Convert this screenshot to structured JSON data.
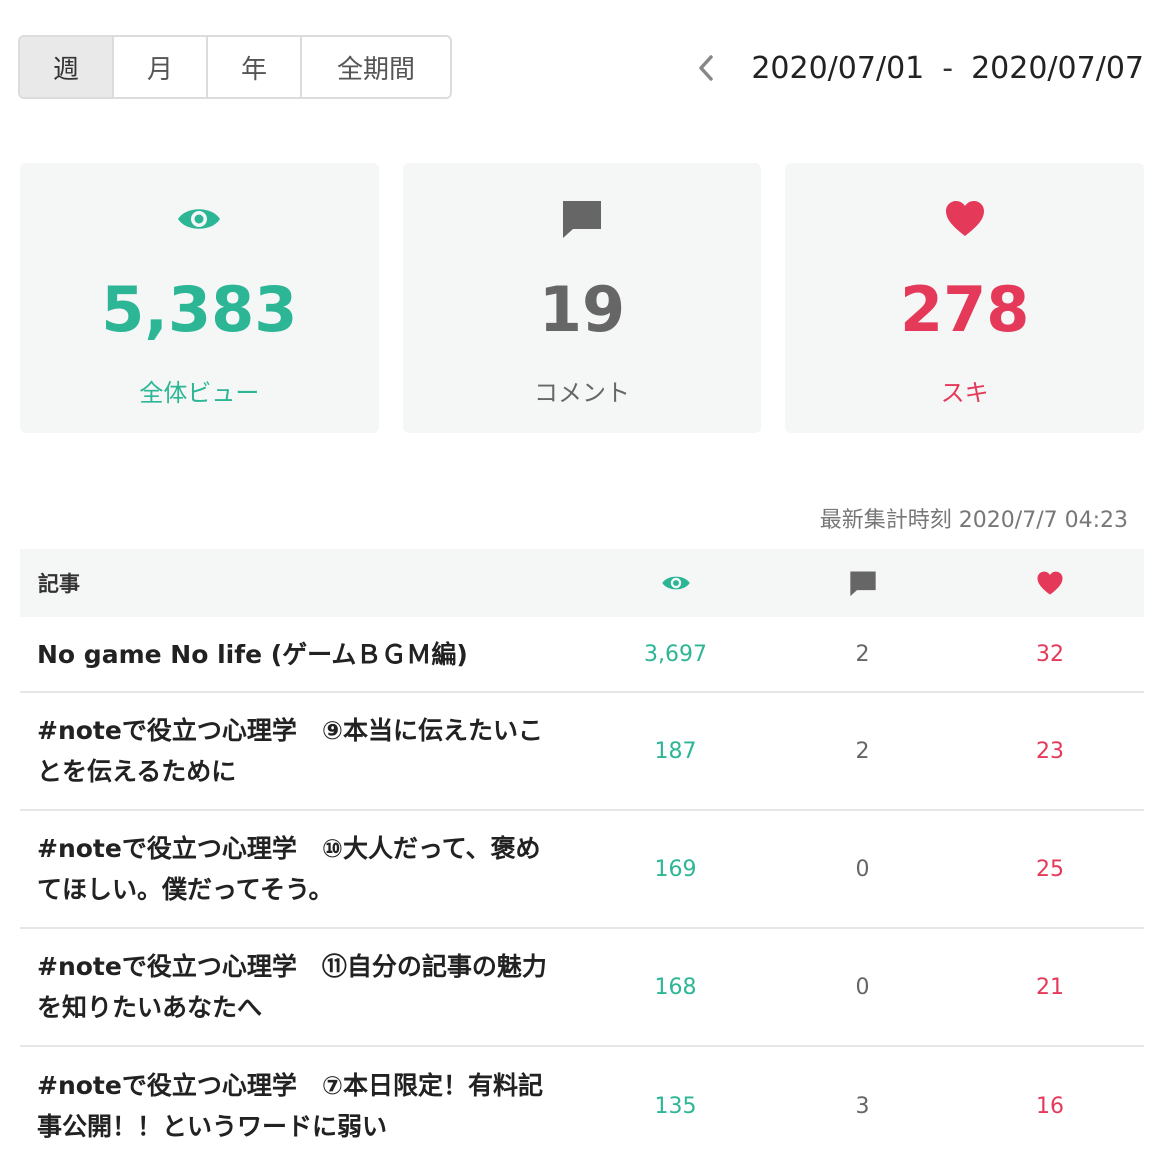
{
  "period_tabs": [
    {
      "label": "週",
      "active": true
    },
    {
      "label": "月",
      "active": false
    },
    {
      "label": "年",
      "active": false
    },
    {
      "label": "全期間",
      "active": false
    }
  ],
  "date_range": {
    "start": "2020/07/01",
    "separator": "-",
    "end": "2020/07/07"
  },
  "stats": {
    "views": {
      "value": "5,383",
      "label": "全体ビュー",
      "icon": "eye-icon",
      "color": "#2cb696"
    },
    "comments": {
      "value": "19",
      "label": "コメント",
      "icon": "comment-icon",
      "color": "#666666"
    },
    "likes": {
      "value": "278",
      "label": "スキ",
      "icon": "heart-icon",
      "color": "#e5395a"
    }
  },
  "last_updated": "最新集計時刻 2020/7/7 04:23",
  "table": {
    "header_title": "記事",
    "rows": [
      {
        "title": "No game No life (ゲームＢＧＭ編)",
        "views": "3,697",
        "comments": "2",
        "likes": "32"
      },
      {
        "title": "#noteで役立つ心理学　⑨本当に伝えたいことを伝えるために",
        "views": "187",
        "comments": "2",
        "likes": "23"
      },
      {
        "title": "#noteで役立つ心理学　⑩大人だって、褒めてほしい。僕だってそう。",
        "views": "169",
        "comments": "0",
        "likes": "25"
      },
      {
        "title": "#noteで役立つ心理学　⑪自分の記事の魅力を知りたいあなたへ",
        "views": "168",
        "comments": "0",
        "likes": "21"
      },
      {
        "title": "#noteで役立つ心理学　⑦本日限定！有料記事公開！！というワードに弱い",
        "views": "135",
        "comments": "3",
        "likes": "16"
      }
    ]
  }
}
